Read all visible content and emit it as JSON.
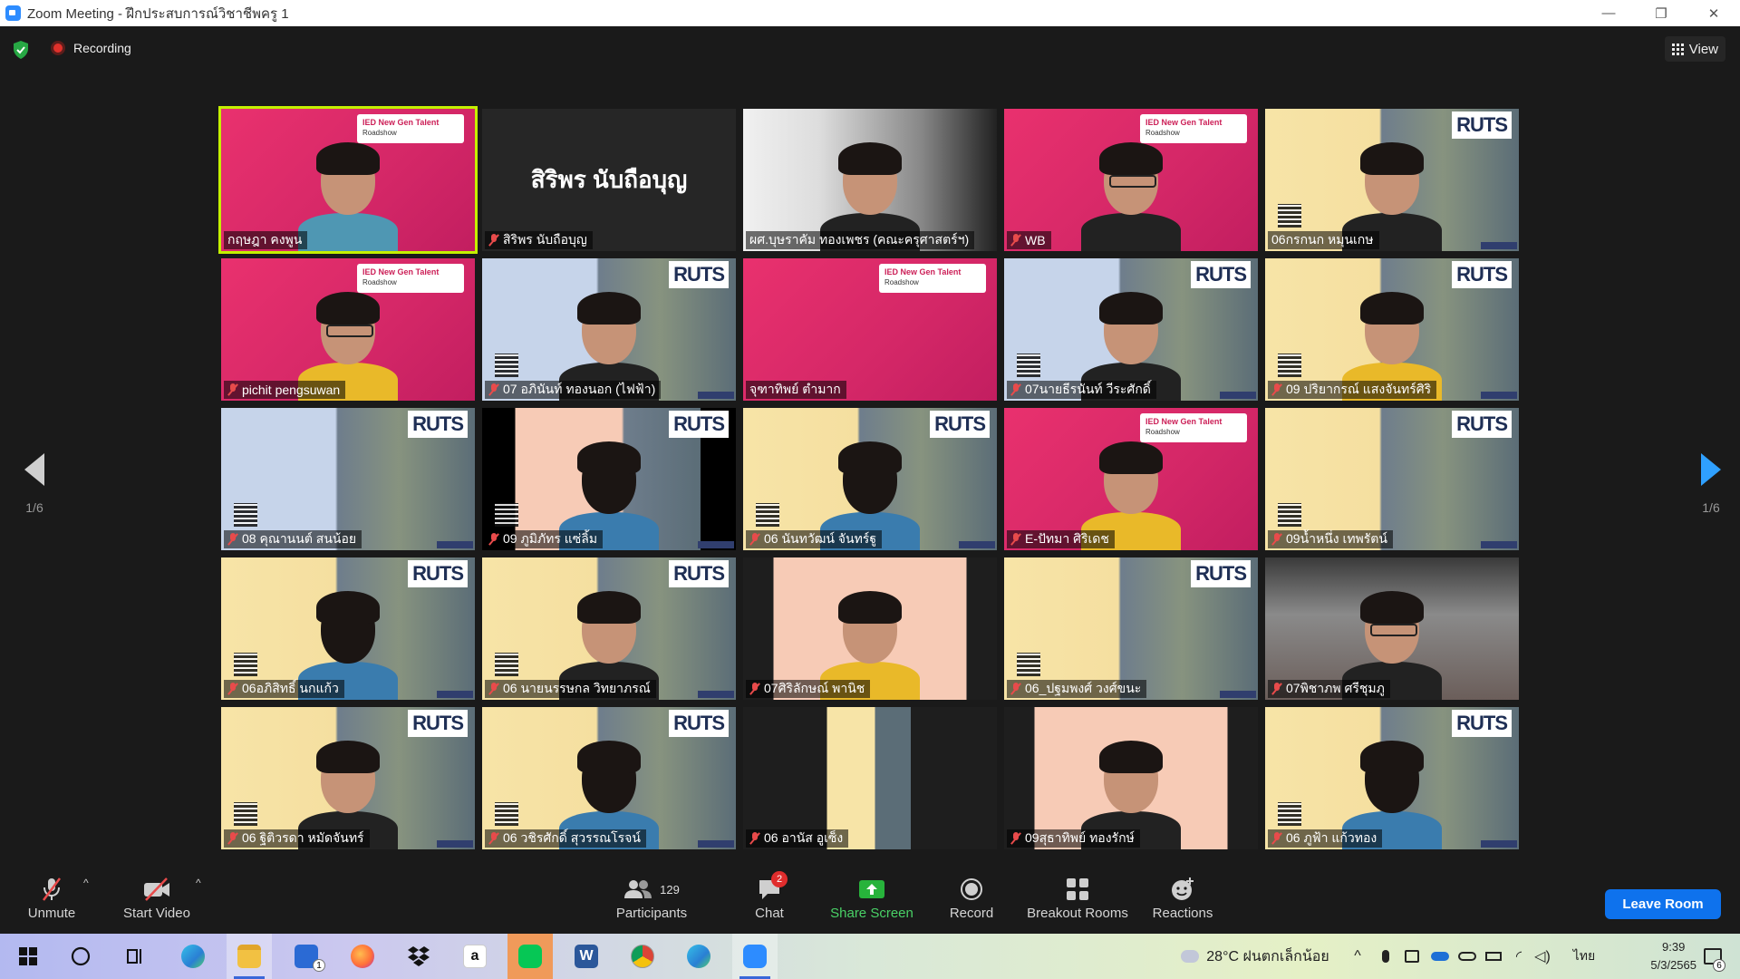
{
  "window": {
    "title": "Zoom Meeting - ฝึกประสบการณ์วิชาชีพครู 1",
    "controls": [
      "—",
      "❐",
      "✕"
    ]
  },
  "topbar": {
    "recording_label": "Recording",
    "view_label": "View"
  },
  "pager": {
    "left_page": "1/6",
    "right_page": "1/6"
  },
  "participants": [
    {
      "name": "กฤษฎา คงพูน",
      "bg": "pink",
      "muted": false,
      "active": true,
      "person": "teal"
    },
    {
      "name": "สิริพร นับถือบุญ",
      "bg": "name-only",
      "muted": true,
      "big_name": "สิริพร นับถือบุญ"
    },
    {
      "name": "ผศ.บุษราคัม ทองเพชร (คณะครุศาสตร์ฯ)",
      "bg": "grayroom",
      "muted": false,
      "person": "dark"
    },
    {
      "name": "WB",
      "bg": "pink",
      "muted": true,
      "person": "dark glasses"
    },
    {
      "name": "06กรกนก หมุนเกษ",
      "bg": "ruts",
      "muted": false,
      "person": "dark"
    },
    {
      "name": "pichit pengsuwan",
      "bg": "pink",
      "muted": true,
      "person": "yellow glasses"
    },
    {
      "name": "07 อภินันท์ ทองนอก (ไฟฟ้า)",
      "bg": "ruts2",
      "muted": true,
      "person": "dark"
    },
    {
      "name": "จุฑาทิพย์ ตำมาก",
      "bg": "pink",
      "muted": false
    },
    {
      "name": "07นายธีรนันท์ วีระศักดิ์",
      "bg": "ruts2",
      "muted": true,
      "person": "dark"
    },
    {
      "name": "09 ปริยากรณ์ แสงจันทร์ศิริ",
      "bg": "ruts",
      "muted": true,
      "person": "yellow"
    },
    {
      "name": "08 คุณานนต์ สนน้อย",
      "bg": "ruts2",
      "muted": true
    },
    {
      "name": "09 ภูมิภัทร แซ่ลิ้ม",
      "bg": "peach",
      "muted": true,
      "person": "back"
    },
    {
      "name": "06 นันทวัฒน์ จันทร์ฐู",
      "bg": "ruts",
      "muted": true,
      "person": "back"
    },
    {
      "name": "E-ปัทมา ศิริเดช",
      "bg": "pink",
      "muted": true,
      "person": "yellow"
    },
    {
      "name": "09น้ำหนึ่ง เทพรัตน์",
      "bg": "ruts",
      "muted": true
    },
    {
      "name": "06อภิสิทธิ์ นกแก้ว",
      "bg": "ruts",
      "muted": true,
      "person": "back"
    },
    {
      "name": "06 นายนรรษกล วิทยาภรณ์",
      "bg": "ruts",
      "muted": true,
      "person": "dark"
    },
    {
      "name": "07ศิริลักษณ์ พานิช",
      "bg": "black-peach",
      "muted": true,
      "person": "yellow"
    },
    {
      "name": "06_ปฐมพงศ์ วงศ์ขนะ",
      "bg": "ruts",
      "muted": true
    },
    {
      "name": "07พิชาภพ ศรีชุมภู",
      "bg": "roomdark",
      "muted": true,
      "person": "dark glasses"
    },
    {
      "name": "06 ฐิติวรดา หมัดจันทร์",
      "bg": "ruts",
      "muted": true,
      "person": "dark"
    },
    {
      "name": "06 วชิรศักดิ์ สุวรรณโรจน์",
      "bg": "ruts",
      "muted": true,
      "person": "back"
    },
    {
      "name": "06 อานัส อูเซ็ง",
      "bg": "black-yellow",
      "muted": true
    },
    {
      "name": "09สุธาทิพย์ ทองรักษ์",
      "bg": "black-peach",
      "muted": true,
      "person": "dark"
    },
    {
      "name": "06 ภูฟ้า แก้วทอง",
      "bg": "ruts",
      "muted": true,
      "person": "back"
    }
  ],
  "banner": {
    "pink_line1": "IED New Gen Talent",
    "pink_line2": "Roadshow",
    "ruts_logo": "RUTS"
  },
  "toolbar": {
    "unmute": "Unmute",
    "start_video": "Start Video",
    "participants_label": "Participants",
    "participants_count": "129",
    "chat_label": "Chat",
    "chat_badge": "2",
    "share_label": "Share Screen",
    "record_label": "Record",
    "breakout_label": "Breakout Rooms",
    "reactions_label": "Reactions",
    "leave_label": "Leave Room"
  },
  "taskbar": {
    "weather": "28°C  ฝนตกเล็กน้อย",
    "lang": "ไทย",
    "time": "9:39",
    "date": "5/3/2565",
    "notif_count": "6",
    "mail_badge": "1"
  },
  "colors": {
    "active_speaker": "#c4f000",
    "leave_button": "#0e72ed",
    "share_green": "#49d166",
    "zoom_blue": "#2d8cff"
  }
}
